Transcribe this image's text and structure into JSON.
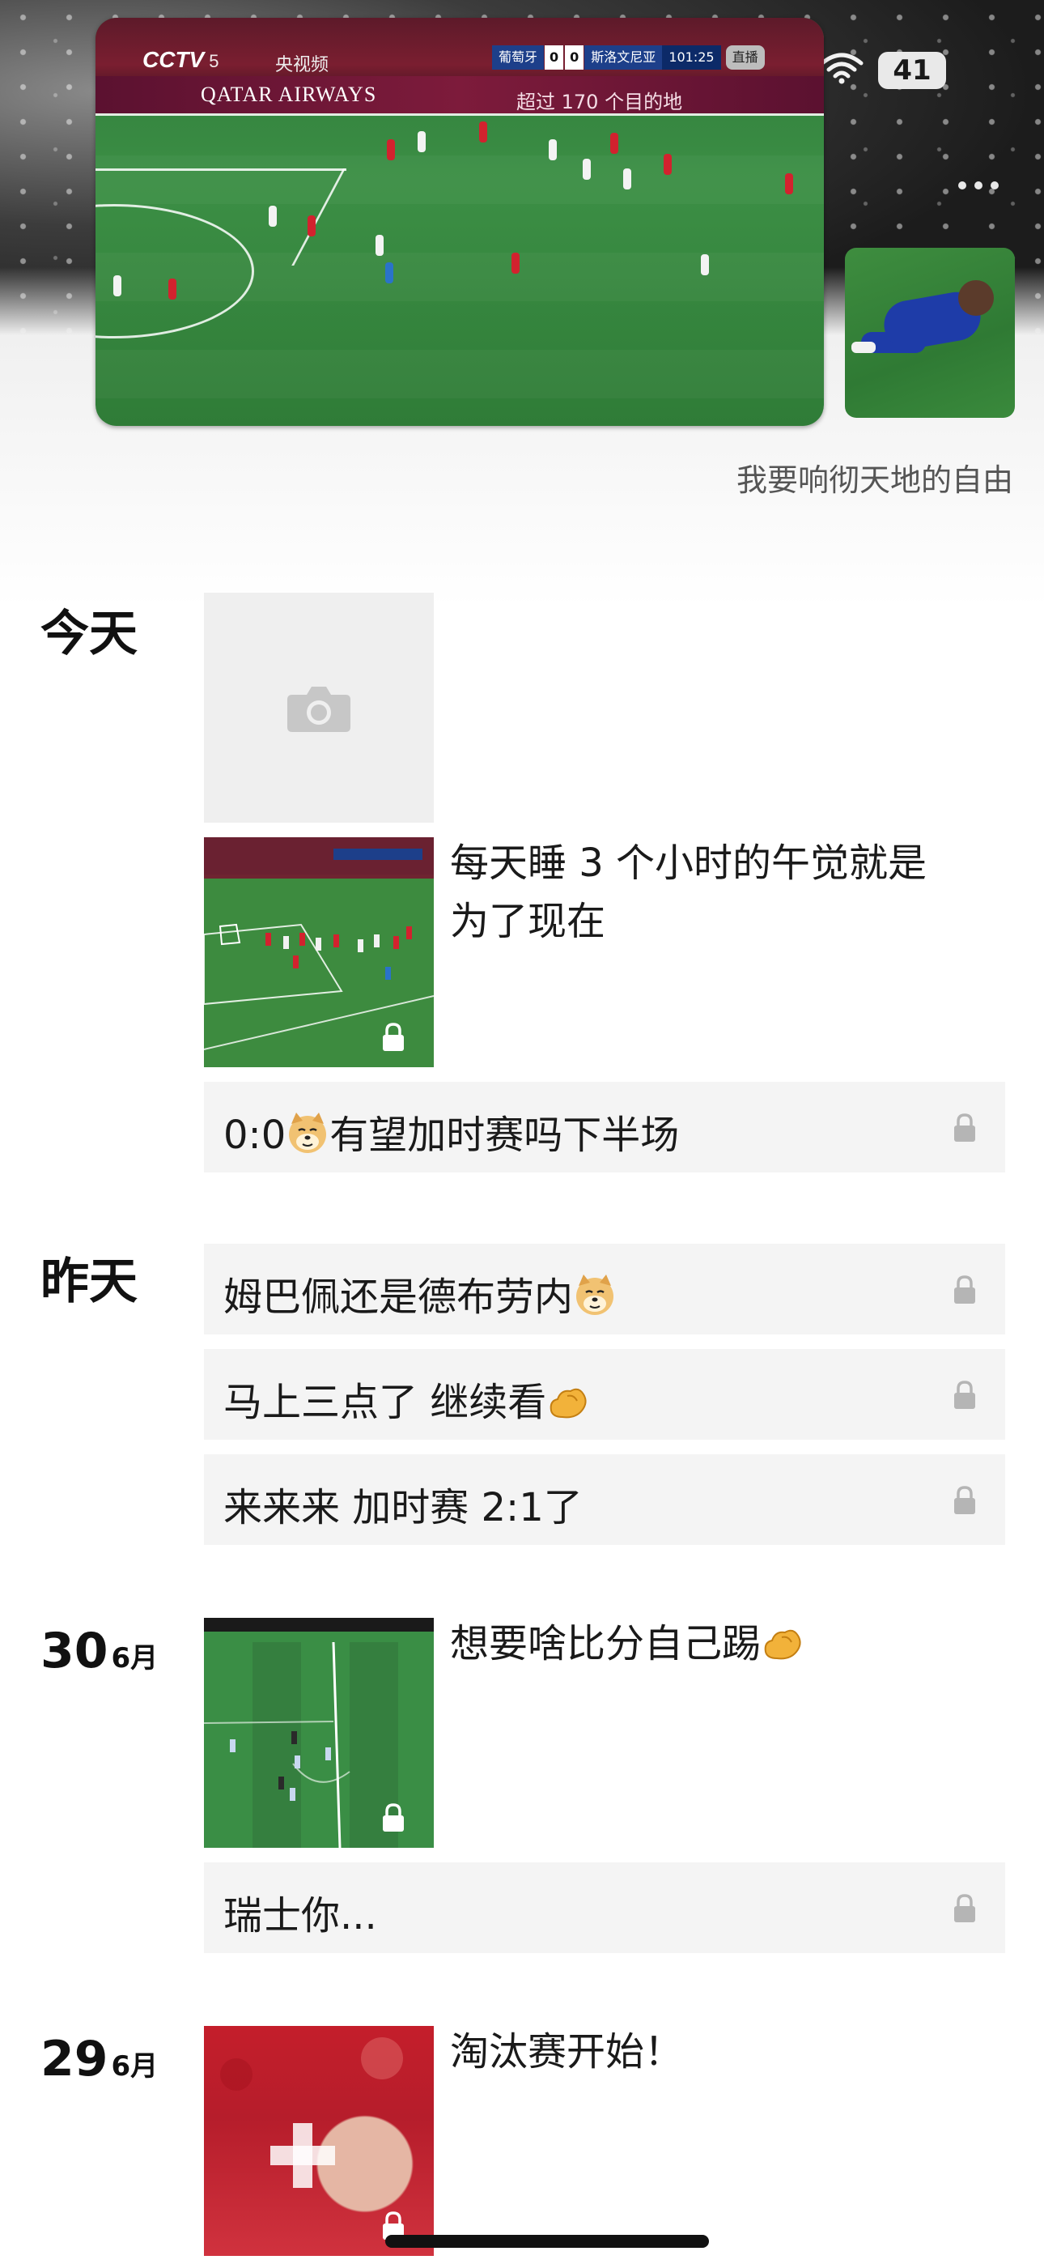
{
  "status_bar": {
    "battery": "41",
    "wifi_icon": "wifi-icon"
  },
  "cover": {
    "video": {
      "channel": "CCTV",
      "channel_num": "5",
      "app_name": "央视频",
      "ad_text": "QATAR AIRWAYS",
      "ad_text2": "超过 170 个目的地",
      "scoreboard": {
        "team1": "葡萄牙",
        "score1": "0",
        "score2": "0",
        "team2": "斯洛文尼亚",
        "time": "101:25",
        "badge": "直播"
      }
    },
    "signature": "我要响彻天地的自由"
  },
  "moments": [
    {
      "date": "今天",
      "placeholder_icon": "camera-icon",
      "image_post": {
        "text_line1": "每天睡 3 个小时的午觉就是",
        "text_line2": "为了现在"
      },
      "text_posts": [
        "0:0|有望加时赛吗下半场"
      ]
    },
    {
      "date": "昨天",
      "text_posts": [
        "姆巴佩还是德布劳内",
        "马上三点了 继续看",
        "来来来 加时赛 2:1了"
      ]
    },
    {
      "day": "30",
      "month": "6月",
      "image_post": {
        "text": "想要啥比分自己踢"
      },
      "text_posts": [
        "瑞士你..."
      ]
    },
    {
      "day": "29",
      "month": "6月",
      "image_post": {
        "text": "淘汰赛开始！"
      }
    }
  ],
  "colors": {
    "page_bg": "#ffffff",
    "row_bg": "#f4f4f4",
    "pitch_green": "#3d8b3f",
    "lock_gray": "#b5b5b5"
  }
}
